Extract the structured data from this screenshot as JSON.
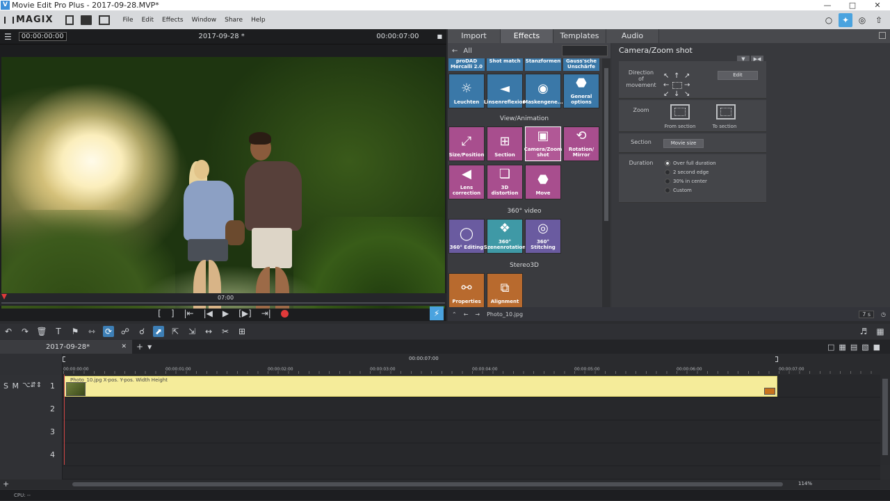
{
  "window": {
    "title": "Movie Edit Pro Plus - 2017-09-28.MVP*",
    "app_icon": "V"
  },
  "menubar": {
    "logo": "MAGIX",
    "items": [
      "File",
      "Edit",
      "Effects",
      "Window",
      "Share",
      "Help"
    ]
  },
  "preview": {
    "timecode_left": "00:00:00:00",
    "title": "2017-09-28 *",
    "timecode_right": "00:00:07:00",
    "scrub_time": "07:00"
  },
  "tabs": [
    "Import",
    "Effects",
    "Templates",
    "Audio"
  ],
  "active_tab": "Effects",
  "browser": {
    "filter": "All",
    "top_strip": [
      "proDAD Mercalli 2.0",
      "Shot match",
      "Stanzformen",
      "Gauss'sche Unschärfe"
    ],
    "row1": [
      "Leuchten",
      "Linsenreflexion",
      "Maskengene...",
      "General options"
    ],
    "sections": [
      "View/Animation",
      "360° video",
      "Stereo3D"
    ],
    "view_anim": [
      "Size/Position",
      "Section",
      "Camera/Zoom shot",
      "Rotation/ Mirror",
      "Lens correction",
      "3D distortion",
      "Move"
    ],
    "video360": [
      "360° Editing",
      "360° Szenenrotation",
      "360° Stitching"
    ],
    "stereo": [
      "Properties",
      "Alignment"
    ]
  },
  "props": {
    "title": "Camera/Zoom shot",
    "direction_label": "Direction of movement",
    "edit_button": "Edit",
    "zoom_label": "Zoom",
    "from_section": "From section",
    "to_section": "To section",
    "section_label": "Section",
    "movie_size_button": "Movie size",
    "duration_label": "Duration",
    "duration_options": [
      "Over full duration",
      "2 second edge",
      "30% in center",
      "Custom"
    ]
  },
  "pool_bottom": {
    "file": "Photo_10.jpg",
    "duration": "7 s"
  },
  "timeline": {
    "tab": "2017-09-28*",
    "ruler_top": "00:00:07:00",
    "ruler_labels": [
      "00:00:00:00",
      "00:00:01:00",
      "00:00:02:00",
      "00:00:03:00",
      "00:00:04:00",
      "00:00:05:00",
      "00:00:06:00",
      "00:00:07:00"
    ],
    "tracks": [
      "1",
      "2",
      "3",
      "4"
    ],
    "track1_controls": "S M",
    "clip_label": "Photo_10.jpg  X-pos.  Y-pos.  Width  Height",
    "zoom": "114%"
  },
  "status": {
    "cpu": "CPU: --"
  },
  "colors": {
    "accent": "#4aa3df",
    "record": "#e03a3a",
    "clip": "#f5ec9a"
  }
}
